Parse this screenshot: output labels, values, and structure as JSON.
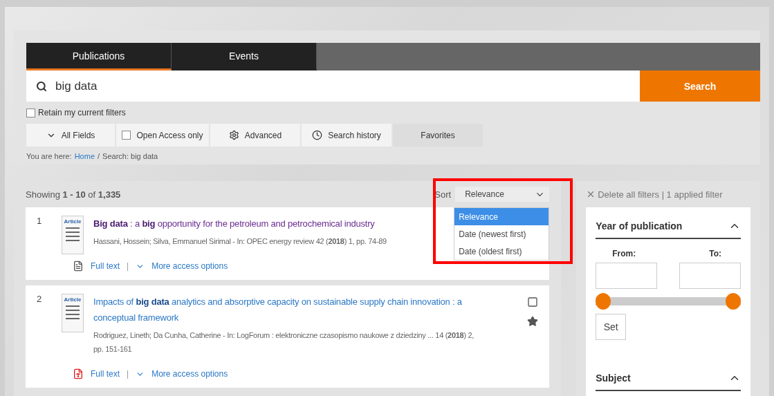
{
  "tabs": [
    {
      "label": "Publications",
      "selected": true
    },
    {
      "label": "Events",
      "selected": false
    }
  ],
  "search": {
    "value": "big data",
    "button": "Search"
  },
  "retain_filters": {
    "label": "Retain my current filters",
    "checked": false
  },
  "options": [
    {
      "kind": "dropdown",
      "label": "All Fields"
    },
    {
      "kind": "checkbox",
      "label": "Open Access only",
      "checked": false
    },
    {
      "kind": "gear",
      "label": "Advanced"
    },
    {
      "kind": "clock",
      "label": "Search history"
    },
    {
      "kind": "plain",
      "label": "Favorites"
    }
  ],
  "breadcrumb": {
    "prefix": "You are here:",
    "separator": "/",
    "items": [
      "Home",
      "Search: big data"
    ]
  },
  "results_summary": "Showing **1 - 10** of **1,335**",
  "sort": {
    "label": "Sort",
    "value": "Relevance",
    "options": [
      {
        "label": "Relevance",
        "selected": true
      },
      {
        "label": "Date (newest first)",
        "selected": false
      },
      {
        "label": "Date (oldest first)",
        "selected": false
      }
    ]
  },
  "results": [
    {
      "number": "1",
      "type": "Article",
      "title": "**Big data** : a **big** opportunity for the petroleum and petrochemical industry",
      "visited": true,
      "authors": "Hassani, Hossein; Silva, Emmanuel Sirimal - In: OPEC energy review 42 (**2018**) 1, pp. 74-89",
      "full_text": {
        "kind": "document",
        "label": "Full text"
      },
      "separator": "|",
      "more": "More access options",
      "actions": false
    },
    {
      "number": "2",
      "type": "Article",
      "title": "Impacts of **big data** analytics and absorptive capacity on sustainable supply chain innovation : a conceptual framework",
      "visited": false,
      "authors": "Rodriguez, Lineth; Da Cunha, Catherine - In: LogForum : elektroniczne czasopismo naukowe z dziedziny ... 14 (**2018**) 2, pp. 151-161",
      "full_text": {
        "kind": "pdf",
        "label": "Full text"
      },
      "separator": "|",
      "more": "More access options",
      "actions": true
    }
  ],
  "filters": {
    "delete_all": "Delete all filters | 1 applied filter",
    "year": {
      "title": "Year of publication",
      "expanded": true,
      "from": "From:",
      "to": "To:",
      "thumbs": [
        {
          "level": 0
        },
        {
          "level": 1
        }
      ],
      "set": "Set"
    },
    "subject": {
      "title": "Subject",
      "expanded": true
    }
  }
}
